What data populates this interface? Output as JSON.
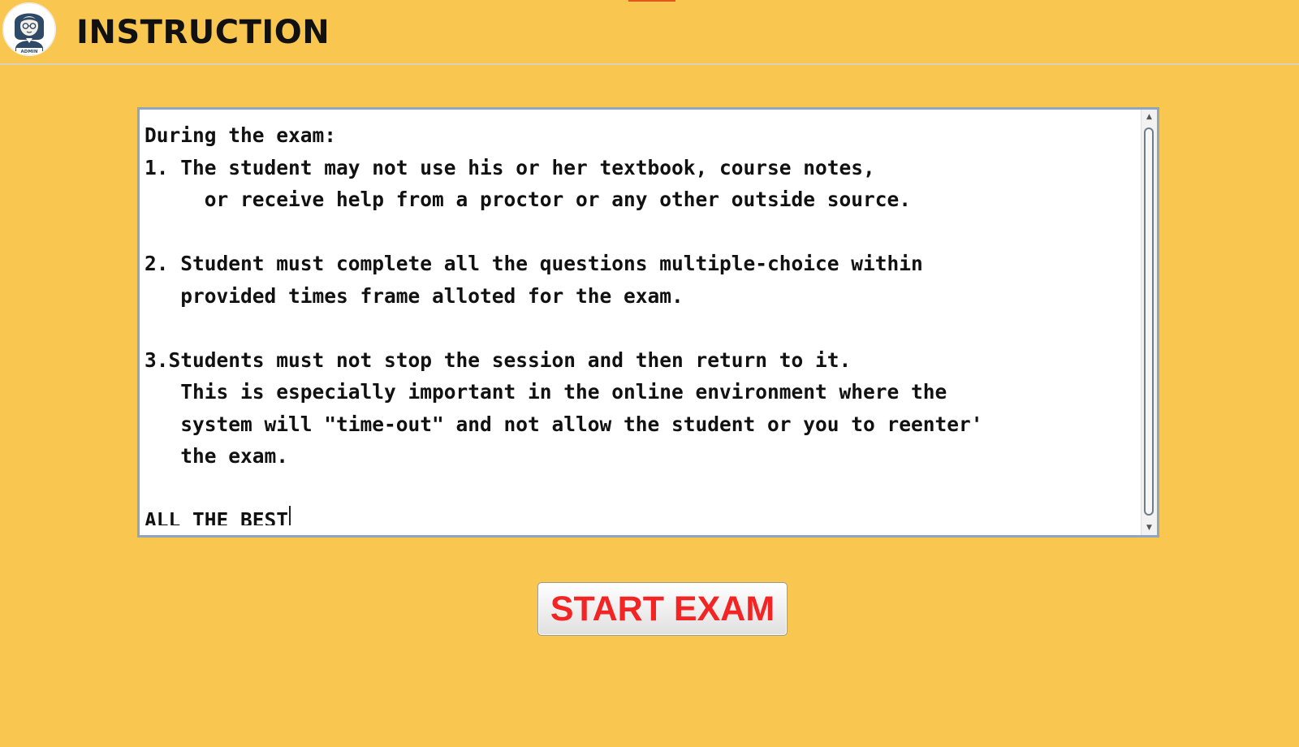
{
  "header": {
    "avatar_label": "ADMIN",
    "title": "INSTRUCTION"
  },
  "instructions": {
    "text": "During the exam:\n1. The student may not use his or her textbook, course notes,\n     or receive help from a proctor or any other outside source.\n\n2. Student must complete all the questions multiple-choice within\n   provided times frame alloted for the exam.\n\n3.Students must not stop the session and then return to it.\n   This is especially important in the online environment where the\n   system will \"time-out\" and not allow the student or you to reenter'\n   the exam.\n\nALL THE BEST"
  },
  "actions": {
    "start_label": "START EXAM"
  },
  "colors": {
    "background": "#F9C74F",
    "button_text": "#F22424",
    "text_area_border": "#8FA6BD"
  }
}
